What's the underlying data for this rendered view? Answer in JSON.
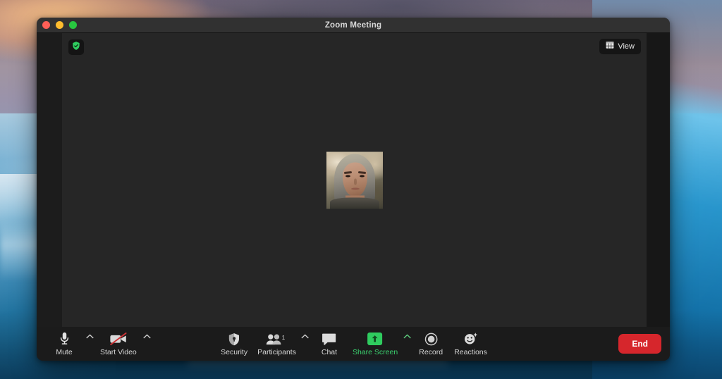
{
  "window": {
    "title": "Zoom Meeting",
    "traffic_lights": [
      {
        "name": "close",
        "color": "#ff5f57"
      },
      {
        "name": "minimize",
        "color": "#febc2e"
      },
      {
        "name": "maximize",
        "color": "#28c840"
      }
    ]
  },
  "stage": {
    "encryption_badge": {
      "icon": "shield-check-icon",
      "color": "#2fcc5f",
      "tooltip": ""
    },
    "view_button": {
      "label": "View",
      "icon": "grid-view-icon"
    },
    "participant_tile": {
      "name": "",
      "icon": "participant-video"
    }
  },
  "toolbar": {
    "mute": {
      "label": "Mute",
      "icon": "microphone-icon",
      "has_caret": true
    },
    "video": {
      "label": "Start Video",
      "icon": "video-off-icon",
      "has_caret": true
    },
    "security": {
      "label": "Security",
      "icon": "shield-icon"
    },
    "participants": {
      "label": "Participants",
      "icon": "people-icon",
      "count": "1",
      "has_caret": true
    },
    "chat": {
      "label": "Chat",
      "icon": "chat-bubble-icon"
    },
    "share_screen": {
      "label": "Share Screen",
      "icon": "share-up-arrow-icon",
      "has_caret": true,
      "color": "#3bd16f"
    },
    "record": {
      "label": "Record",
      "icon": "record-circle-icon"
    },
    "reactions": {
      "label": "Reactions",
      "icon": "smiley-sparkle-icon"
    },
    "end": {
      "label": "End",
      "color": "#d6262c"
    }
  }
}
